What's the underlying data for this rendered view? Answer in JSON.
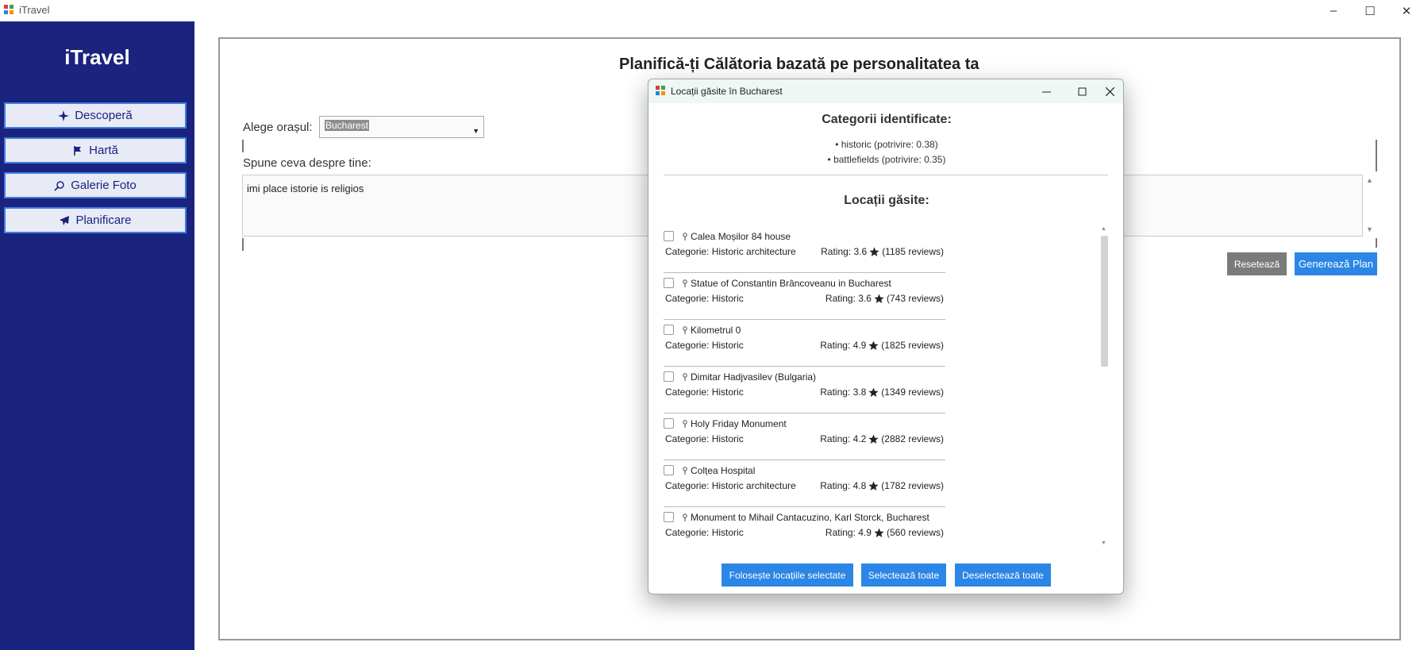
{
  "window": {
    "title": "iTravel",
    "controls": {
      "minimize": "–",
      "maximize": "☐",
      "close": "✕"
    }
  },
  "sidebar": {
    "brand": "iTravel",
    "items": [
      {
        "label": "Descoperă",
        "icon": "sparkles-icon"
      },
      {
        "label": "Hartă",
        "icon": "flag-icon"
      },
      {
        "label": "Galerie Foto",
        "icon": "search-icon"
      },
      {
        "label": "Planificare",
        "icon": "airplane-icon"
      }
    ]
  },
  "main": {
    "title": "Planifică-ți Călătoria bazată pe personalitatea ta",
    "city_label": "Alege orașul:",
    "city_value": "Bucharest",
    "about_label": "Spune ceva despre tine:",
    "about_text": "imi place istorie is religios",
    "reset_label": "Resetează",
    "generate_label": "Generează Plan"
  },
  "dialog": {
    "title": "Locații găsite în Bucharest",
    "categories_heading": "Categorii identificate:",
    "categories": [
      "• historic (potrivire: 0.38)",
      "• battlefields (potrivire: 0.35)"
    ],
    "locations_heading": "Locații găsite:",
    "locations": [
      {
        "name": "Calea Moșilor 84 house",
        "category": "Categorie: Historic architecture",
        "rating": "Rating: 3.6",
        "reviews": "(1185 reviews)"
      },
      {
        "name": "Statue of Constantin Brâncoveanu in Bucharest",
        "category": "Categorie: Historic",
        "rating": "Rating: 3.6",
        "reviews": "(743 reviews)"
      },
      {
        "name": "Kilometrul 0",
        "category": "Categorie: Historic",
        "rating": "Rating: 4.9",
        "reviews": "(1825 reviews)"
      },
      {
        "name": "Dimitar Hadjvasilev (Bulgaria)",
        "category": "Categorie: Historic",
        "rating": "Rating: 3.8",
        "reviews": "(1349 reviews)"
      },
      {
        "name": "Holy Friday Monument",
        "category": "Categorie: Historic",
        "rating": "Rating: 4.2",
        "reviews": "(2882 reviews)"
      },
      {
        "name": "Colțea Hospital",
        "category": "Categorie: Historic architecture",
        "rating": "Rating: 4.8",
        "reviews": "(1782 reviews)"
      },
      {
        "name": "Monument to Mihail Cantacuzino, Karl Storck, Bucharest",
        "category": "Categorie: Historic",
        "rating": "Rating: 4.9",
        "reviews": "(560 reviews)"
      }
    ],
    "use_selected_label": "Folosește locațiile selectate",
    "select_all_label": "Selectează toate",
    "deselect_all_label": "Deselectează toate"
  },
  "colors": {
    "sidebar_bg": "#1a237e",
    "accent_blue": "#2b86e6",
    "reset_gray": "#7b7b7b",
    "nav_button_bg": "#e8eaf6"
  }
}
